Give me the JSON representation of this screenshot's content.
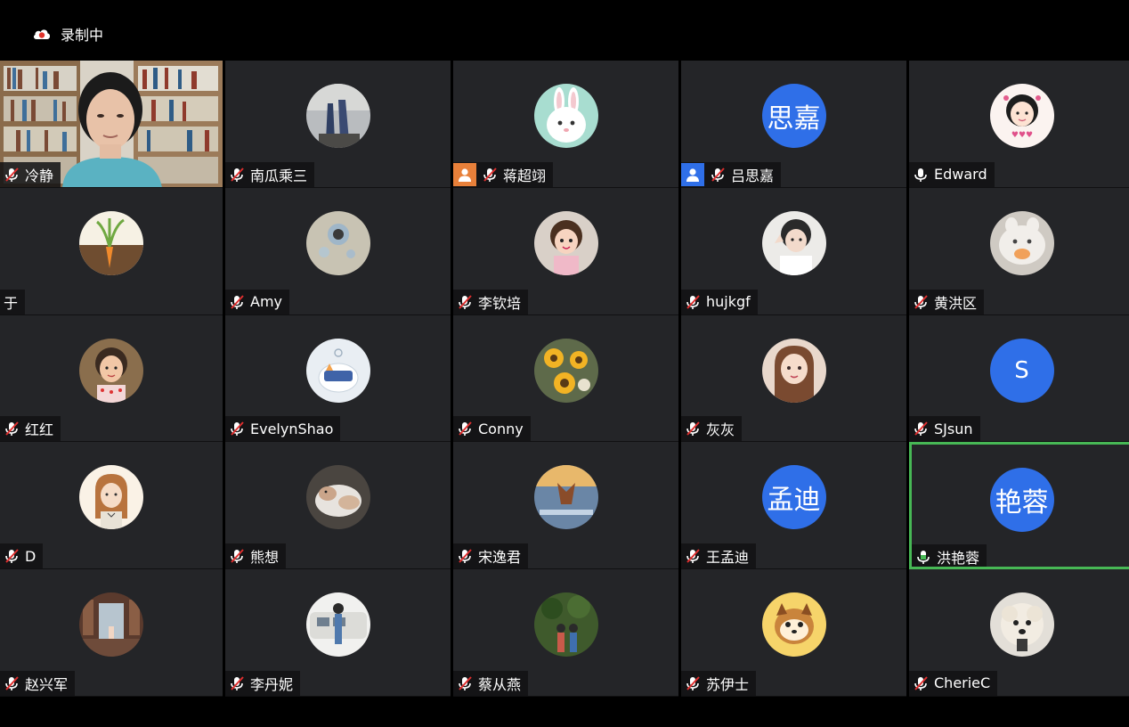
{
  "recording": {
    "label": "录制中",
    "icon": "cloud-record-icon"
  },
  "colors": {
    "tile_bg": "#242528",
    "active_border": "#47b855",
    "initials_bg": "#2f6fe8"
  },
  "participants": [
    {
      "name": "冷静",
      "mic": "muted",
      "video": true
    },
    {
      "name": "南瓜乘三",
      "mic": "muted"
    },
    {
      "name": "蒋超翊",
      "mic": "muted",
      "badge": "orange"
    },
    {
      "name": "吕思嘉",
      "mic": "muted",
      "badge": "blue",
      "initials": "思嘉"
    },
    {
      "name": "Edward",
      "mic": "on"
    },
    {
      "name": "于",
      "mic": "none"
    },
    {
      "name": "Amy",
      "mic": "muted"
    },
    {
      "name": "李钦培",
      "mic": "muted"
    },
    {
      "name": "hujkgf",
      "mic": "muted"
    },
    {
      "name": "黄洪区",
      "mic": "muted"
    },
    {
      "name": "红红",
      "mic": "muted"
    },
    {
      "name": "EvelynShao",
      "mic": "muted"
    },
    {
      "name": "Conny",
      "mic": "muted"
    },
    {
      "name": "灰灰",
      "mic": "muted"
    },
    {
      "name": "SJsun",
      "mic": "muted",
      "initials": "S"
    },
    {
      "name": "D",
      "mic": "muted"
    },
    {
      "name": "熊想",
      "mic": "muted"
    },
    {
      "name": "宋逸君",
      "mic": "muted"
    },
    {
      "name": "王孟迪",
      "mic": "muted",
      "initials": "孟迪"
    },
    {
      "name": "洪艳蓉",
      "mic": "speaking",
      "initials": "艳蓉",
      "active": true
    },
    {
      "name": "赵兴军",
      "mic": "muted"
    },
    {
      "name": "李丹妮",
      "mic": "muted"
    },
    {
      "name": "蔡从燕",
      "mic": "muted"
    },
    {
      "name": "苏伊士",
      "mic": "muted"
    },
    {
      "name": "CherieC",
      "mic": "muted"
    }
  ]
}
